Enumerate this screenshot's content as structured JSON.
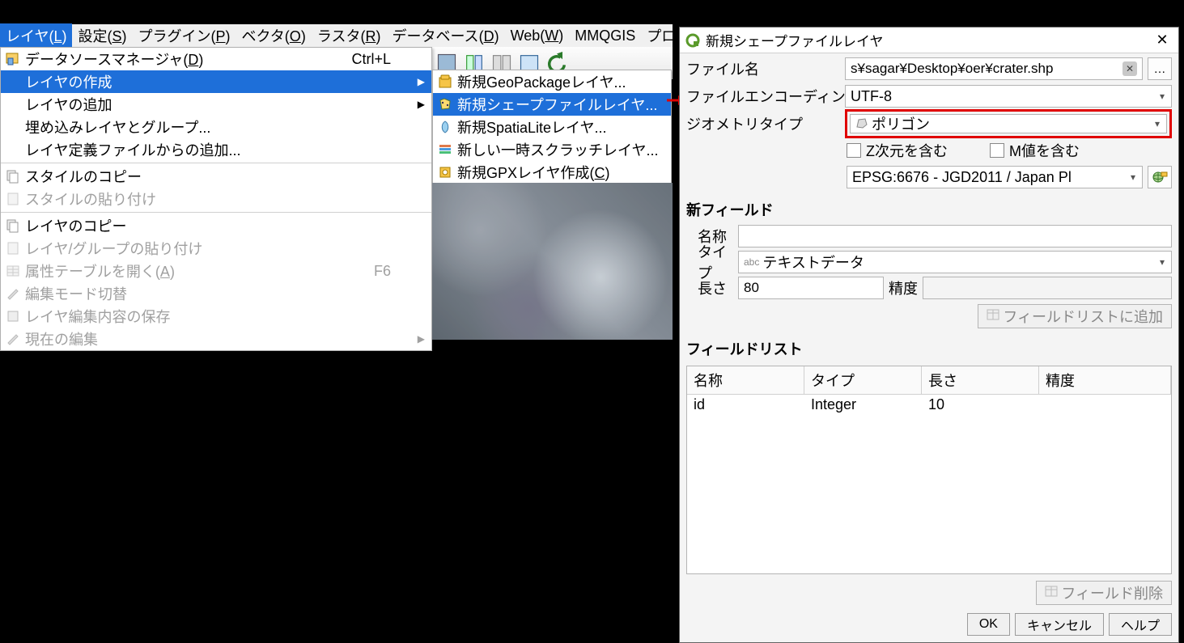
{
  "menubar": {
    "items": [
      {
        "label": "レイヤ",
        "mnemonic": "L",
        "selected": true
      },
      {
        "label": "設定",
        "mnemonic": "S"
      },
      {
        "label": "プラグイン",
        "mnemonic": "P"
      },
      {
        "label": "ベクタ",
        "mnemonic": "O"
      },
      {
        "label": "ラスタ",
        "mnemonic": "R"
      },
      {
        "label": "データベース",
        "mnemonic": "D"
      },
      {
        "label": "Web",
        "mnemonic": "W"
      },
      {
        "label": "MMQGIS"
      },
      {
        "label": "プロ"
      }
    ]
  },
  "dropdown": {
    "data_source_manager": {
      "label": "データソースマネージャ",
      "mnemonic": "D",
      "shortcut": "Ctrl+L"
    },
    "create_layer": {
      "label": "レイヤの作成"
    },
    "add_layer": {
      "label": "レイヤの追加"
    },
    "embed_layer": {
      "label": "埋め込みレイヤとグループ..."
    },
    "add_def_file": {
      "label": "レイヤ定義ファイルからの追加..."
    },
    "copy_style": {
      "label": "スタイルのコピー"
    },
    "paste_style": {
      "label": "スタイルの貼り付け"
    },
    "copy_layer": {
      "label": "レイヤのコピー"
    },
    "paste_layer": {
      "label": "レイヤ/グループの貼り付け"
    },
    "open_attr": {
      "label": "属性テーブルを開く",
      "mnemonic": "A",
      "shortcut": "F6"
    },
    "toggle_edit": {
      "label": "編集モード切替"
    },
    "save_edits": {
      "label": "レイヤ編集内容の保存"
    },
    "current_edits": {
      "label": "現在の編集"
    }
  },
  "submenu": {
    "geopackage": {
      "label": "新規GeoPackageレイヤ..."
    },
    "shapefile": {
      "label": "新規シェープファイルレイヤ..."
    },
    "spatialite": {
      "label": "新規SpatiaLiteレイヤ..."
    },
    "scratch": {
      "label": "新しい一時スクラッチレイヤ..."
    },
    "gpx": {
      "label": "新規GPXレイヤ作成",
      "mnemonic": "C"
    }
  },
  "dialog": {
    "title": "新規シェープファイルレイヤ",
    "filename_label": "ファイル名",
    "filename_value": "s¥sagar¥Desktop¥oer¥crater.shp",
    "browse": "…",
    "encoding_label": "ファイルエンコーディング",
    "encoding_value": "UTF-8",
    "geom_label": "ジオメトリタイプ",
    "geom_value": "ポリゴン",
    "z_label": "Z次元を含む",
    "m_label": "M値を含む",
    "crs_value": "EPSG:6676 - JGD2011 / Japan Pl",
    "new_field_section": "新フィールド",
    "fname_label": "名称",
    "fname_value": "",
    "ftype_label": "タイプ",
    "ftype_prefix": "abc",
    "ftype_value": "テキストデータ",
    "flen_label": "長さ",
    "flen_value": "80",
    "fprec_label": "精度",
    "fprec_value": "",
    "add_field_btn": "フィールドリストに追加",
    "field_list_section": "フィールドリスト",
    "columns": {
      "name": "名称",
      "type": "タイプ",
      "len": "長さ",
      "prec": "精度"
    },
    "rows": [
      {
        "name": "id",
        "type": "Integer",
        "len": "10",
        "prec": ""
      }
    ],
    "remove_field_btn": "フィールド削除",
    "ok": "OK",
    "cancel": "キャンセル",
    "help": "ヘルプ"
  }
}
